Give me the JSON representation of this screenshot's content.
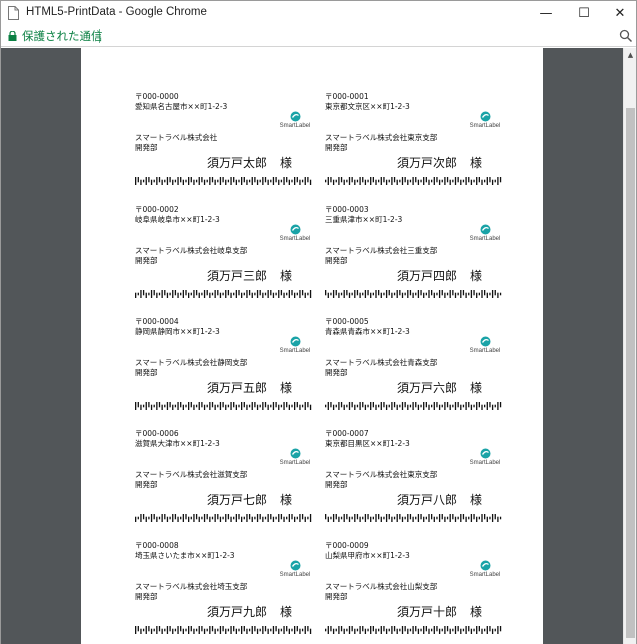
{
  "window": {
    "title": "HTML5-PrintData - Google Chrome",
    "minimize_glyph": "—",
    "maximize_glyph": "☐",
    "close_glyph": "✕"
  },
  "address_bar": {
    "secure_label": "保護された通信",
    "icons": [
      "lock-icon",
      "zoom-icon"
    ]
  },
  "colors": {
    "viewer_bg": "#525659",
    "secure_green": "#0b8043",
    "logo_teal": "#1aa3a7"
  },
  "labels": [
    {
      "postal": "〒000-0000",
      "address": "愛知県名古屋市××町1-2-3",
      "company": "スマートラベル株式会社",
      "dept": "開発部",
      "name": "須万戸太郎",
      "honorific": "様",
      "logo": "SmartLabel"
    },
    {
      "postal": "〒000-0001",
      "address": "東京都文京区××町1-2-3",
      "company": "スマートラベル株式会社東京支部",
      "dept": "開発部",
      "name": "須万戸次郎",
      "honorific": "様",
      "logo": "SmartLabel"
    },
    {
      "postal": "〒000-0002",
      "address": "岐阜県岐阜市××町1-2-3",
      "company": "スマートラベル株式会社岐阜支部",
      "dept": "開発部",
      "name": "須万戸三郎",
      "honorific": "様",
      "logo": "SmartLabel"
    },
    {
      "postal": "〒000-0003",
      "address": "三重県津市××町1-2-3",
      "company": "スマートラベル株式会社三重支部",
      "dept": "開発部",
      "name": "須万戸四郎",
      "honorific": "様",
      "logo": "SmartLabel"
    },
    {
      "postal": "〒000-0004",
      "address": "静岡県静岡市××町1-2-3",
      "company": "スマートラベル株式会社静岡支部",
      "dept": "開発部",
      "name": "須万戸五郎",
      "honorific": "様",
      "logo": "SmartLabel"
    },
    {
      "postal": "〒000-0005",
      "address": "青森県青森市××町1-2-3",
      "company": "スマートラベル株式会社青森支部",
      "dept": "開発部",
      "name": "須万戸六郎",
      "honorific": "様",
      "logo": "SmartLabel"
    },
    {
      "postal": "〒000-0006",
      "address": "滋賀県大津市××町1-2-3",
      "company": "スマートラベル株式会社滋賀支部",
      "dept": "開発部",
      "name": "須万戸七郎",
      "honorific": "様",
      "logo": "SmartLabel"
    },
    {
      "postal": "〒000-0007",
      "address": "東京都目黒区××町1-2-3",
      "company": "スマートラベル株式会社東京支部",
      "dept": "開発部",
      "name": "須万戸八郎",
      "honorific": "様",
      "logo": "SmartLabel"
    },
    {
      "postal": "〒000-0008",
      "address": "埼玉県さいたま市××町1-2-3",
      "company": "スマートラベル株式会社埼玉支部",
      "dept": "開発部",
      "name": "須万戸九郎",
      "honorific": "様",
      "logo": "SmartLabel"
    },
    {
      "postal": "〒000-0009",
      "address": "山梨県甲府市××町1-2-3",
      "company": "スマートラベル株式会社山梨支部",
      "dept": "開発部",
      "name": "須万戸十郎",
      "honorific": "様",
      "logo": "SmartLabel"
    }
  ]
}
